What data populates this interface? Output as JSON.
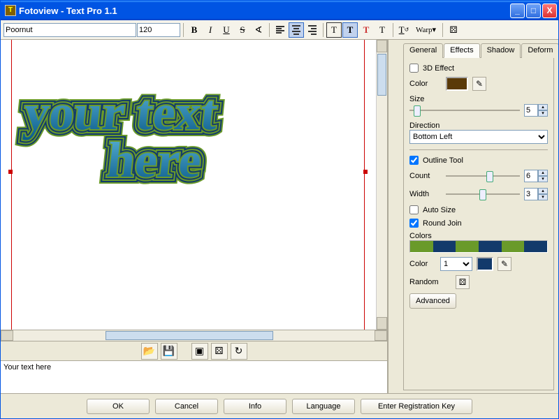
{
  "window": {
    "title": "Fotoview - Text Pro 1.1"
  },
  "toolbar": {
    "font": "Poornut",
    "size": "120",
    "warp_label": "Warp"
  },
  "canvas": {
    "line1": "your text",
    "line2": "here"
  },
  "text_input": "Your text here",
  "tabs": {
    "general": "General",
    "effects": "Effects",
    "shadow": "Shadow",
    "deform": "Deform"
  },
  "effects": {
    "effect3d_label": "3D Effect",
    "color_label": "Color",
    "effect3d_color": "#5a3a08",
    "size_label": "Size",
    "size_value": "5",
    "direction_label": "Direction",
    "direction_value": "Bottom Left",
    "outline_label": "Outline Tool",
    "count_label": "Count",
    "count_value": "6",
    "width_label": "Width",
    "width_value": "3",
    "autosize_label": "Auto Size",
    "roundjoin_label": "Round Join",
    "colors_label": "Colors",
    "color2_label": "Color",
    "color_index": "1",
    "selected_color": "#123a6b",
    "random_label": "Random",
    "advanced_label": "Advanced",
    "gradient": [
      "#6a9a2a",
      "#123a6b",
      "#6a9a2a",
      "#123a6b",
      "#6a9a2a",
      "#123a6b"
    ]
  },
  "buttons": {
    "ok": "OK",
    "cancel": "Cancel",
    "info": "Info",
    "language": "Language",
    "regkey": "Enter Registration Key"
  }
}
